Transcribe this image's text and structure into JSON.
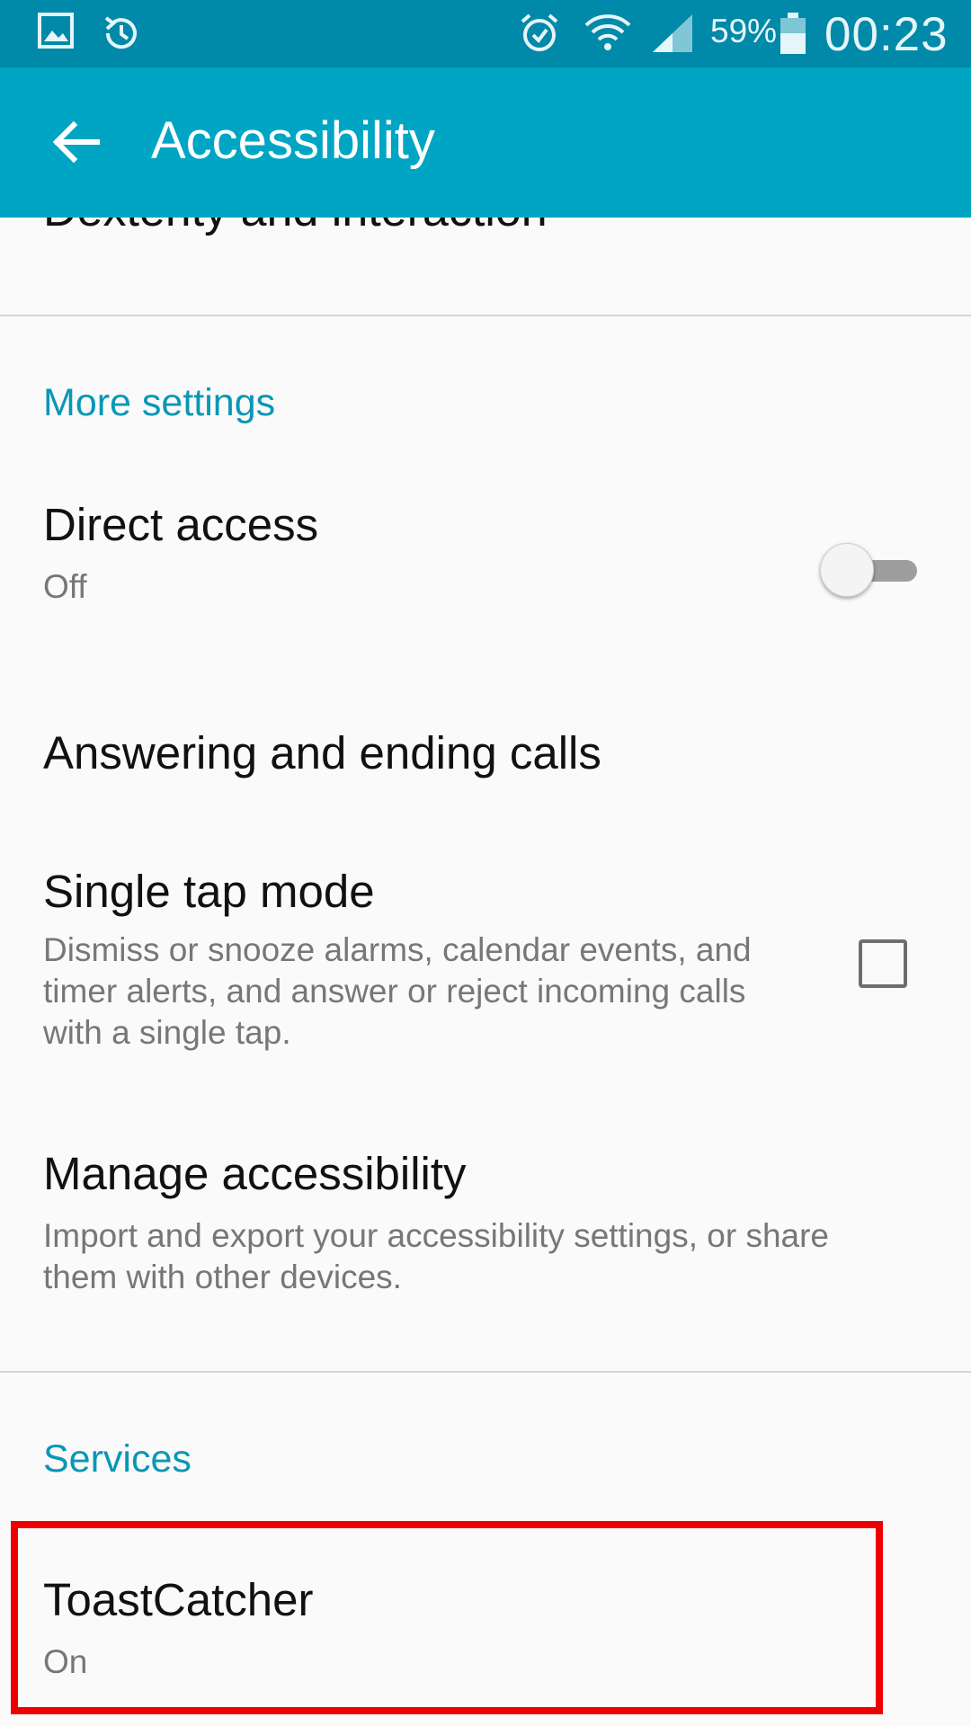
{
  "status_bar": {
    "battery_percent": "59%",
    "time": "00:23",
    "icons": [
      "gallery-icon",
      "alarm-sync-icon",
      "alarm-icon",
      "wifi-icon",
      "signal-icon",
      "battery-icon"
    ]
  },
  "app_bar": {
    "title": "Accessibility",
    "back_icon": "arrow-left-icon"
  },
  "partial_item": {
    "title": "Dexterity and interaction"
  },
  "sections": {
    "more_settings": "More settings",
    "services": "Services"
  },
  "items": {
    "direct_access": {
      "title": "Direct access",
      "subtitle": "Off",
      "toggle_on": false
    },
    "answering_calls": {
      "title": "Answering and ending calls"
    },
    "single_tap": {
      "title": "Single tap mode",
      "line1": "Dismiss or snooze alarms, calendar events, and",
      "line2": "timer alerts, and answer or reject incoming calls",
      "line3": "with a single tap.",
      "checked": false
    },
    "manage_accessibility": {
      "title": "Manage accessibility",
      "line1": "Import and export your accessibility settings, or share",
      "line2": "them with other devices."
    },
    "toast_catcher": {
      "title": "ToastCatcher",
      "subtitle": "On"
    }
  },
  "colors": {
    "status_bar": "#0089a8",
    "app_bar": "#00a5c4",
    "section_header": "#0a97b5",
    "highlight": "#ee0000"
  }
}
